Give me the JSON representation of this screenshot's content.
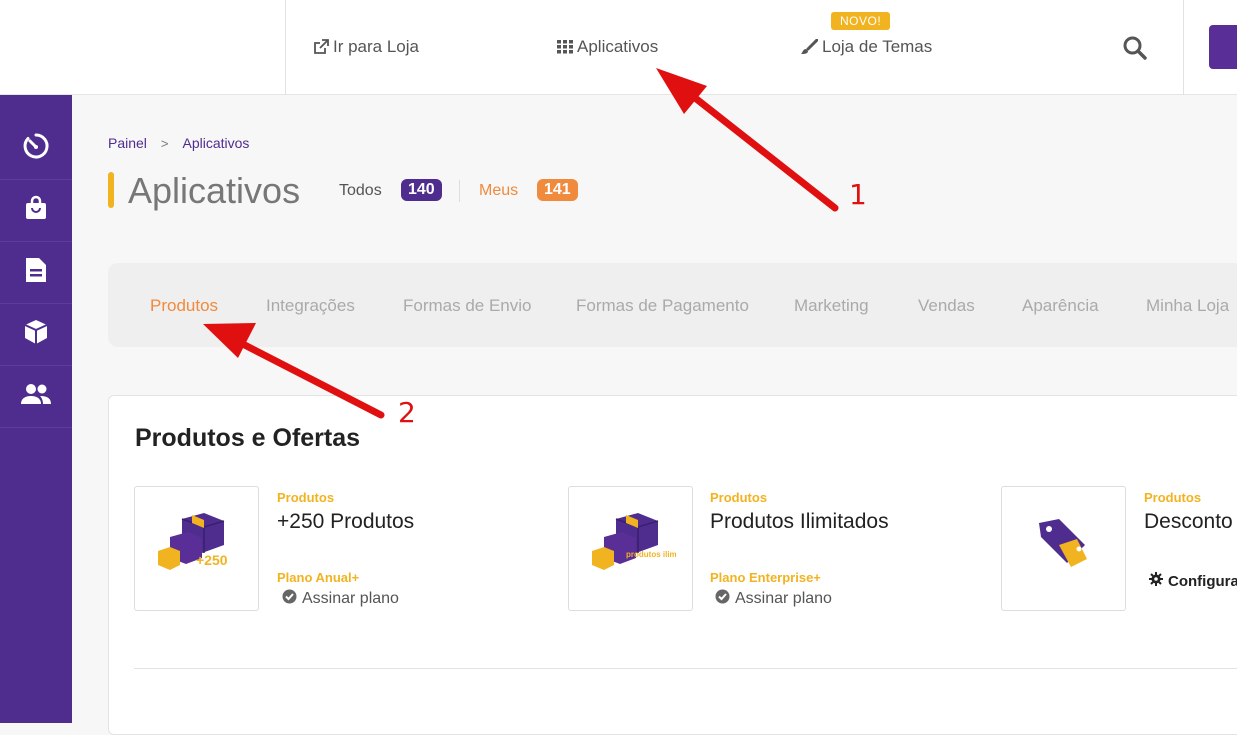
{
  "topbar": {
    "store_link": "Ir para Loja",
    "apps_link": "Aplicativos",
    "themes_link": "Loja de Temas",
    "new_badge": "NOVO!"
  },
  "sidebar": {
    "items": [
      {
        "icon": "timer-icon"
      },
      {
        "icon": "shopping-bag-icon"
      },
      {
        "icon": "document-icon"
      },
      {
        "icon": "box-icon"
      },
      {
        "icon": "users-icon"
      }
    ]
  },
  "breadcrumb": {
    "root": "Painel",
    "separator": ">",
    "current": "Aplicativos"
  },
  "page": {
    "title": "Aplicativos",
    "filter_all_label": "Todos",
    "filter_all_count": "140",
    "filter_mine_label": "Meus",
    "filter_mine_count": "141"
  },
  "tabs": [
    {
      "label": "Produtos",
      "active": true
    },
    {
      "label": "Integrações"
    },
    {
      "label": "Formas de Envio"
    },
    {
      "label": "Formas de Pagamento"
    },
    {
      "label": "Marketing"
    },
    {
      "label": "Vendas"
    },
    {
      "label": "Aparência"
    },
    {
      "label": "Minha Loja"
    }
  ],
  "section": {
    "title": "Produtos e Ofertas",
    "apps": [
      {
        "category": "Produtos",
        "name": "+250 Produtos",
        "plan": "Plano Anual+",
        "action": "Assinar plano",
        "thumb_text": "+250"
      },
      {
        "category": "Produtos",
        "name": "Produtos Ilimitados",
        "plan": "Plano Enterprise+",
        "action": "Assinar plano",
        "thumb_text": "produtos ilimitados"
      },
      {
        "category": "Produtos",
        "name": "Desconto",
        "plan": "",
        "action": "Configura"
      }
    ]
  },
  "annotations": {
    "label_1": "1",
    "label_2": "2"
  },
  "colors": {
    "brand_purple": "#4f2d8f",
    "accent_yellow": "#f2b320",
    "accent_orange": "#f08a3c",
    "arrow_red": "#e01010"
  }
}
